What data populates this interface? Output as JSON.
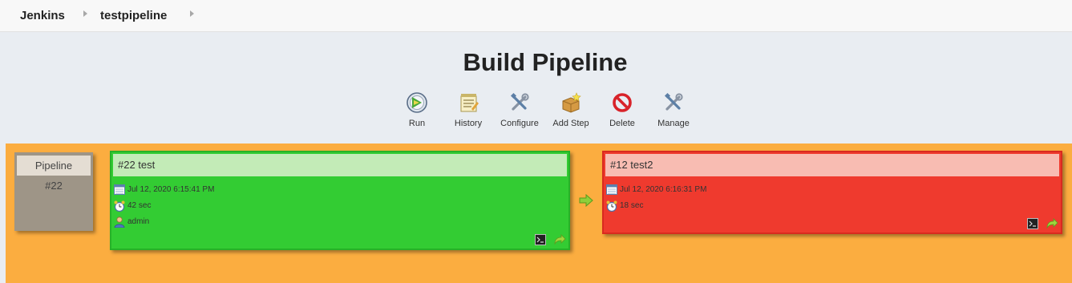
{
  "breadcrumb": {
    "root": "Jenkins",
    "job": "testpipeline"
  },
  "page": {
    "title": "Build Pipeline"
  },
  "toolbar": {
    "run": "Run",
    "history": "History",
    "configure": "Configure",
    "add_step": "Add Step",
    "delete": "Delete",
    "manage": "Manage"
  },
  "pipeline": {
    "label": "Pipeline",
    "number": "#22"
  },
  "builds": [
    {
      "title": "#22 test",
      "date": "Jul 12, 2020 6:15:41 PM",
      "duration": "42 sec",
      "user": "admin",
      "status": "success",
      "color": "#33cc33"
    },
    {
      "title": "#12 test2",
      "date": "Jul 12, 2020 6:16:31 PM",
      "duration": "18 sec",
      "status": "failed",
      "color": "#ef3a2e"
    }
  ],
  "colors": {
    "pipeline_bg": "#fbad40",
    "success": "#33cc33",
    "failure": "#ef3a2e"
  }
}
